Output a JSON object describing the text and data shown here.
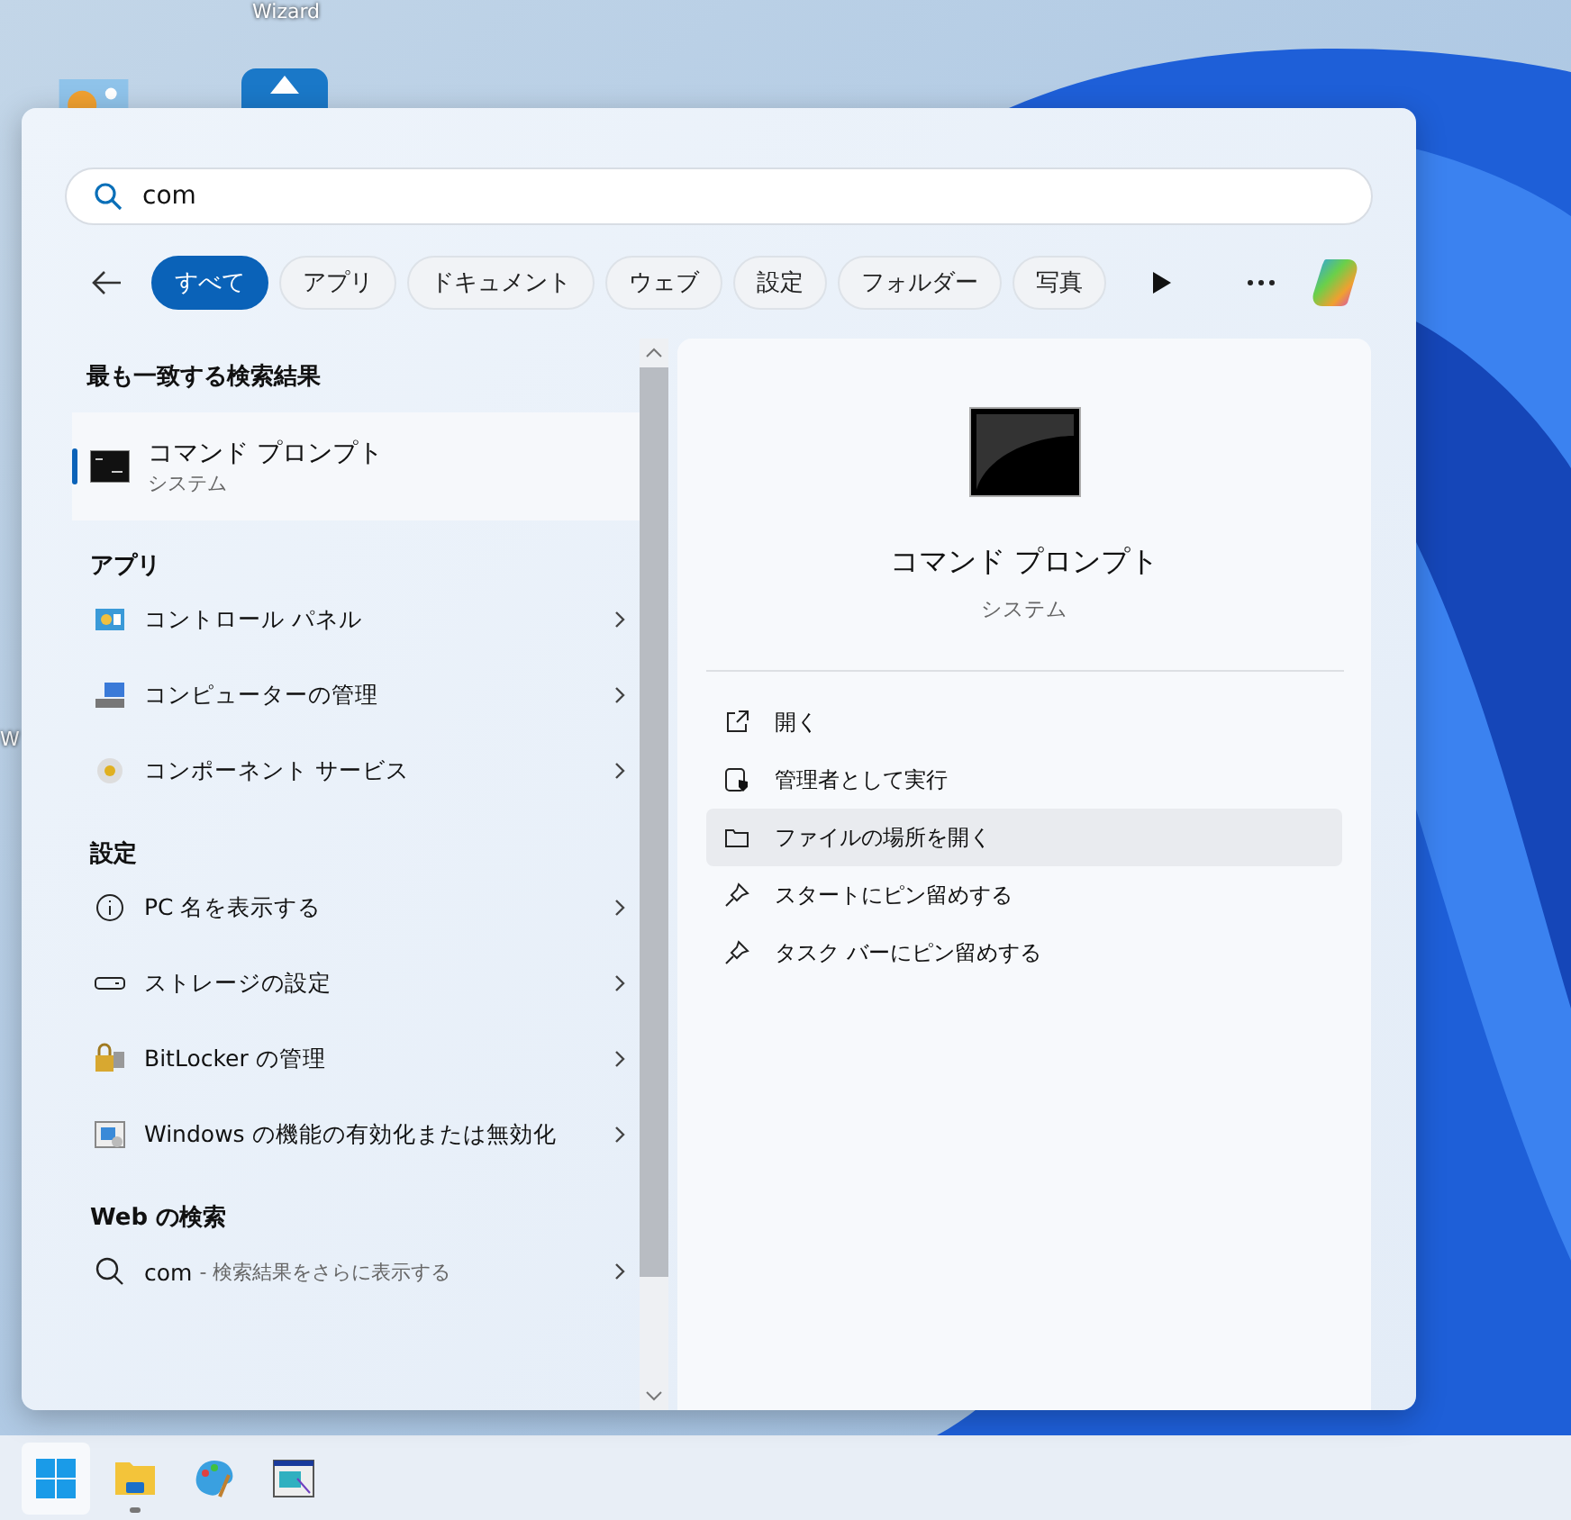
{
  "desktop": {
    "icon_labels": [
      "Wizard",
      "W"
    ]
  },
  "search": {
    "value": "com"
  },
  "filters": [
    {
      "label": "すべて",
      "selected": true
    },
    {
      "label": "アプリ",
      "selected": false
    },
    {
      "label": "ドキュメント",
      "selected": false
    },
    {
      "label": "ウェブ",
      "selected": false
    },
    {
      "label": "設定",
      "selected": false
    },
    {
      "label": "フォルダー",
      "selected": false
    },
    {
      "label": "写真",
      "selected": false
    }
  ],
  "best_match": {
    "heading": "最も一致する検索結果",
    "title": "コマンド プロンプト",
    "subtitle": "システム",
    "selected": true
  },
  "sections": [
    {
      "heading": "アプリ",
      "items": [
        {
          "kind": "panel",
          "label": "コントロール パネル"
        },
        {
          "kind": "computer",
          "label": "コンピューターの管理"
        },
        {
          "kind": "component",
          "label": "コンポーネント サービス"
        }
      ]
    },
    {
      "heading": "設定",
      "items": [
        {
          "kind": "info",
          "label": "PC 名を表示する"
        },
        {
          "kind": "storage",
          "label": "ストレージの設定"
        },
        {
          "kind": "lock",
          "label": "BitLocker の管理"
        },
        {
          "kind": "features",
          "label": "Windows の機能の有効化または無効化"
        }
      ]
    },
    {
      "heading": "Web の検索",
      "items": [
        {
          "kind": "search",
          "label": "com",
          "hint": "- 検索結果をさらに表示する"
        }
      ]
    }
  ],
  "detail": {
    "title": "コマンド プロンプト",
    "subtitle": "システム",
    "actions": [
      {
        "kind": "open",
        "label": "開く",
        "selected": false
      },
      {
        "kind": "admin",
        "label": "管理者として実行",
        "selected": false
      },
      {
        "kind": "folder",
        "label": "ファイルの場所を開く",
        "selected": true
      },
      {
        "kind": "pin",
        "label": "スタートにピン留めする",
        "selected": false
      },
      {
        "kind": "pin",
        "label": "タスク バーにピン留めする",
        "selected": false
      }
    ]
  },
  "taskbar": {
    "items": [
      {
        "kind": "start",
        "running": false
      },
      {
        "kind": "explorer",
        "running": true
      },
      {
        "kind": "paint",
        "running": false
      },
      {
        "kind": "window",
        "running": false
      }
    ]
  }
}
